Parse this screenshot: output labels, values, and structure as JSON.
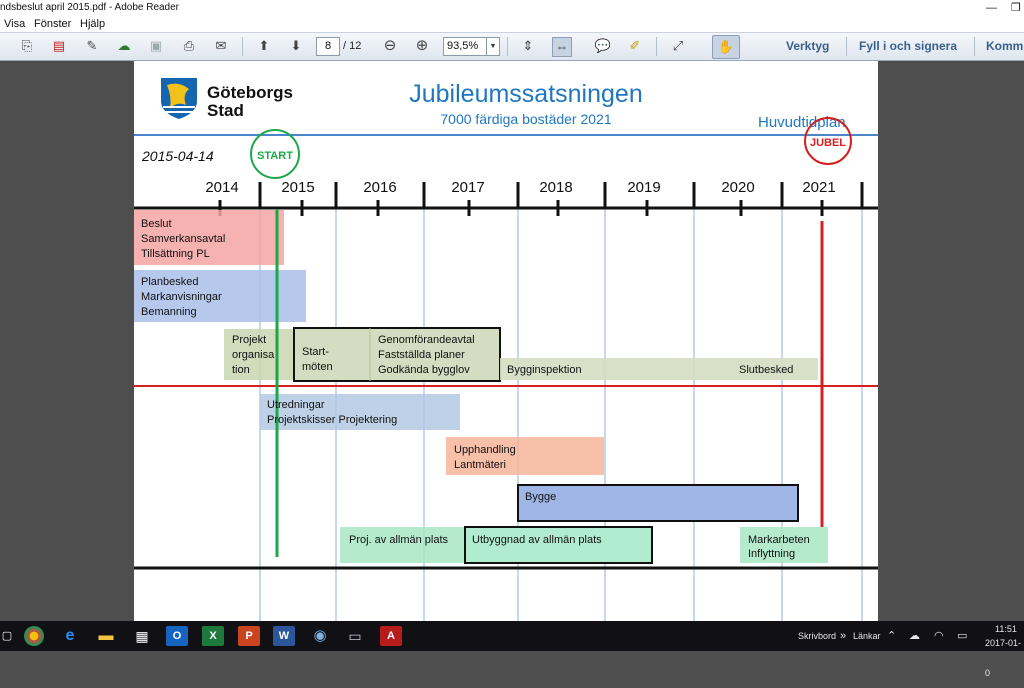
{
  "window": {
    "title": "ndsbeslut april 2015.pdf - Adobe Reader"
  },
  "menu": [
    "Visa",
    "Fönster",
    "Hjälp"
  ],
  "toolbar": {
    "page_current": "8",
    "page_total": "/ 12",
    "zoom": "93,5%",
    "tools_label": "Verktyg",
    "fill_sign_label": "Fyll i och signera",
    "comment_label": "Komm"
  },
  "document": {
    "logo_text_line1": "Göteborgs",
    "logo_text_line2": "Stad",
    "title": "Jubileumssatsningen",
    "subtitle": "7000 färdiga bostäder 2021",
    "plan_label": "Huvudtidplan",
    "date": "2015-04-14",
    "start_label": "START",
    "jubel_label": "JUBEL",
    "years": [
      "2014",
      "2015",
      "2016",
      "2017",
      "2018",
      "2019",
      "2020",
      "2021"
    ],
    "bars": [
      {
        "lines": [
          "Beslut",
          "Samverkansavtal",
          "Tillsättning PL"
        ]
      },
      {
        "lines": [
          "Planbesked",
          "Markanvisningar",
          "Bemanning"
        ]
      },
      {
        "lines": [
          "Projekt",
          "organisa",
          "tion"
        ]
      },
      {
        "lines": [
          "Start-",
          "möten"
        ]
      },
      {
        "lines": [
          "Genomförandeavtal",
          "Fastställda planer",
          "Godkända bygglov"
        ]
      },
      {
        "lines": [
          "Bygginspektion"
        ]
      },
      {
        "lines": [
          "Slutbesked"
        ]
      },
      {
        "lines": [
          "Utredningar",
          "Projektskisser Projektering"
        ]
      },
      {
        "lines": [
          "Upphandling",
          "Lantmäteri"
        ]
      },
      {
        "lines": [
          "Bygge"
        ]
      },
      {
        "lines": [
          "Proj. av allmän plats"
        ]
      },
      {
        "lines": [
          "Utbyggnad av allmän plats"
        ]
      },
      {
        "lines": [
          "Markarbeten",
          "Inflyttning"
        ]
      }
    ]
  },
  "taskbar": {
    "desktop_label": "Skrivbord",
    "links_label": "Länkar",
    "time": "11:51",
    "date": "2017-01-0"
  },
  "colors": {
    "title_blue": "#1f77c0",
    "start_green": "#1aa84a",
    "jubel_red": "#d42020",
    "grid_blue": "#8fb0d8"
  }
}
